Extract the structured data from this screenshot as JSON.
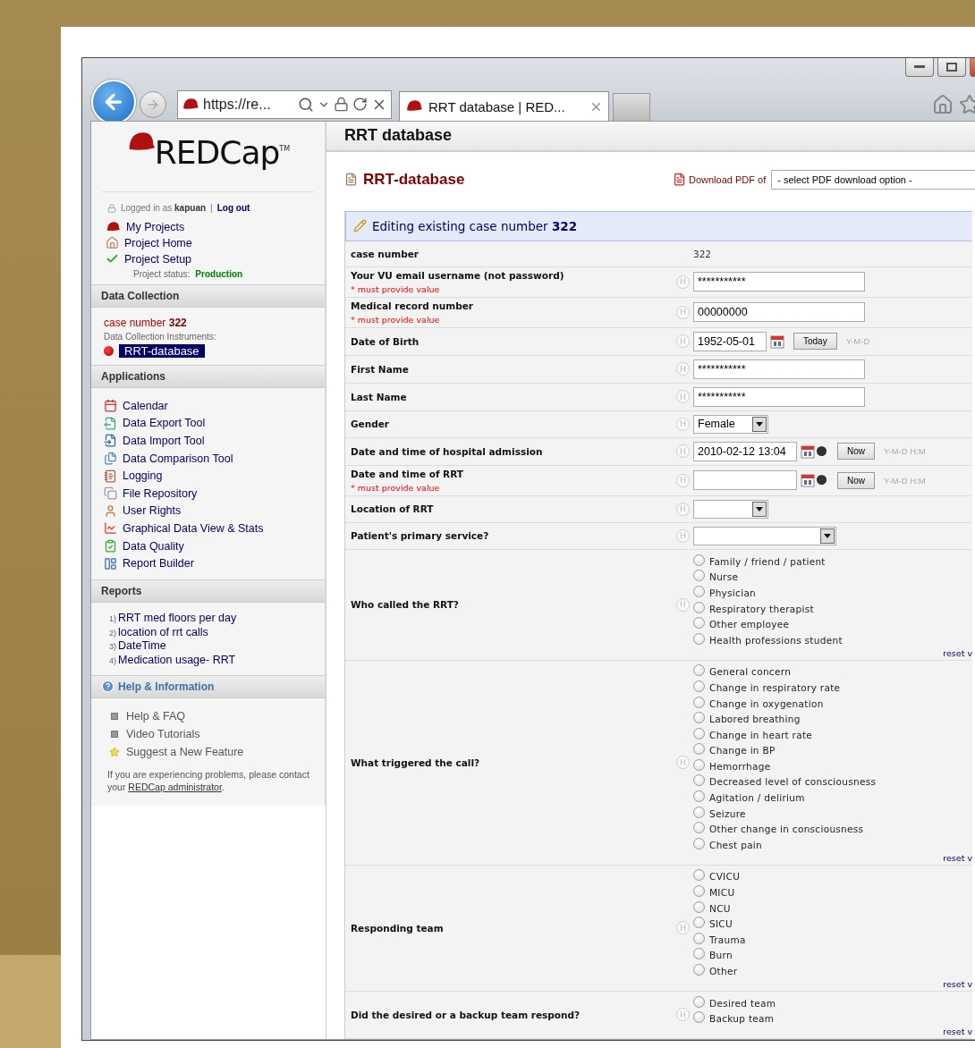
{
  "browser": {
    "address": "https://re...",
    "tab_title": "RRT database | RED..."
  },
  "sidebar": {
    "logo": "REDCap",
    "logo_mark": "TM",
    "login": {
      "prefix": "Logged in as",
      "user": "kapuan",
      "separator": "|",
      "logout": "Log out"
    },
    "nav": [
      {
        "label": "My Projects"
      },
      {
        "label": "Project Home"
      },
      {
        "label": "Project Setup"
      }
    ],
    "project_status": {
      "label": "Project status:",
      "value": "Production"
    },
    "data_collection": {
      "title": "Data Collection",
      "record_label": "case number",
      "record_value": "322",
      "instruments_label": "Data Collection Instruments:",
      "instruments": [
        {
          "label": "RRT-database",
          "selected": true
        }
      ]
    },
    "applications": {
      "title": "Applications",
      "items": [
        {
          "label": "Calendar"
        },
        {
          "label": "Data Export Tool"
        },
        {
          "label": "Data Import Tool"
        },
        {
          "label": "Data Comparison Tool"
        },
        {
          "label": "Logging"
        },
        {
          "label": "File Repository"
        },
        {
          "label": "User Rights"
        },
        {
          "label": "Graphical Data View & Stats"
        },
        {
          "label": "Data Quality"
        },
        {
          "label": "Report Builder"
        }
      ]
    },
    "reports": {
      "title": "Reports",
      "items": [
        {
          "number": "1)",
          "label": "RRT med floors per day"
        },
        {
          "number": "2)",
          "label": "location of rrt calls"
        },
        {
          "number": "3)",
          "label": "DateTime"
        },
        {
          "number": "4)",
          "label": "Medication usage- RRT"
        }
      ]
    },
    "help": {
      "title": "Help & Information",
      "items": [
        {
          "kind": "bullet",
          "label": "Help & FAQ"
        },
        {
          "kind": "bullet",
          "label": "Video Tutorials"
        },
        {
          "kind": "star",
          "label": "Suggest a New Feature"
        }
      ],
      "note": "If you are experiencing problems, please contact your",
      "note_link": "REDCap administrator",
      "note_end": "."
    }
  },
  "main": {
    "page_title": "RRT database",
    "form_title": "RRT-database",
    "pdf": {
      "label": "Download PDF of",
      "select": "- select PDF download option -"
    },
    "editing": {
      "prefix": "Editing existing case number",
      "number": "322"
    },
    "fields": [
      {
        "kind": "static",
        "label": "case number",
        "value": "322"
      },
      {
        "kind": "text",
        "label": "Your VU email username (not password)",
        "note": "* must provide value",
        "help": "H",
        "value": "***********"
      },
      {
        "kind": "text",
        "label": "Medical record number",
        "note": "* must provide value",
        "help": "H",
        "value": "00000000"
      },
      {
        "kind": "date",
        "label": "Date of Birth",
        "help": "H",
        "value": "1952-05-01",
        "button": "Today",
        "format": "Y-M-D"
      },
      {
        "kind": "text",
        "label": "First Name",
        "help": "H",
        "value": "***********"
      },
      {
        "kind": "text",
        "label": "Last Name",
        "help": "H",
        "value": "***********"
      },
      {
        "kind": "select",
        "label": "Gender",
        "help": "H",
        "value": "Female"
      },
      {
        "kind": "datetime",
        "label": "Date and time of hospital admission",
        "help": "H",
        "value": "2010-02-12 13:04",
        "button": "Now",
        "format": "Y-M-D H:M"
      },
      {
        "kind": "datetime",
        "label": "Date and time of RRT",
        "note": "* must provide value",
        "help": "H",
        "button": "Now",
        "format": "Y-M-D H:M"
      },
      {
        "kind": "select",
        "label": "Location of RRT",
        "help": "H"
      },
      {
        "kind": "select_wide",
        "label": "Patient's primary service?",
        "help": "H"
      },
      {
        "kind": "radio",
        "label": "Who called the RRT?",
        "help": "H",
        "reset": "reset v",
        "options": [
          {
            "label": "Family / friend / patient",
            "selected": false
          },
          {
            "label": "Nurse",
            "selected": false
          },
          {
            "label": "Physician",
            "selected": false
          },
          {
            "label": "Respiratory therapist",
            "selected": false
          },
          {
            "label": "Other employee",
            "selected": false
          },
          {
            "label": "Health professions student",
            "selected": false
          }
        ]
      },
      {
        "kind": "radio",
        "label": "What triggered the call?",
        "help": "H",
        "reset": "reset v",
        "options": [
          {
            "label": "General concern",
            "selected": false
          },
          {
            "label": "Change in respiratory rate",
            "selected": false
          },
          {
            "label": "Change in oxygenation",
            "selected": false
          },
          {
            "label": "Labored breathing",
            "selected": false
          },
          {
            "label": "Change in heart rate",
            "selected": false
          },
          {
            "label": "Change in BP",
            "selected": false
          },
          {
            "label": "Hemorrhage",
            "selected": false
          },
          {
            "label": "Decreased level of consciousness",
            "selected": false
          },
          {
            "label": "Agitation / delirium",
            "selected": false
          },
          {
            "label": "Seizure",
            "selected": false
          },
          {
            "label": "Other change in consciousness",
            "selected": false
          },
          {
            "label": "Chest pain",
            "selected": false
          }
        ]
      },
      {
        "kind": "radio",
        "label": "Responding team",
        "help": "H",
        "reset": "reset v",
        "options": [
          {
            "label": "CVICU",
            "selected": false
          },
          {
            "label": "MICU",
            "selected": false
          },
          {
            "label": "NCU",
            "selected": false
          },
          {
            "label": "SICU",
            "selected": false
          },
          {
            "label": "Trauma",
            "selected": false
          },
          {
            "label": "Burn",
            "selected": false
          },
          {
            "label": "Other",
            "selected": false
          }
        ]
      },
      {
        "kind": "radio",
        "label": "Did the desired or a backup team respond?",
        "help": "H",
        "reset": "reset v",
        "options": [
          {
            "label": "Desired team",
            "selected": false
          },
          {
            "label": "Backup team",
            "selected": false
          }
        ]
      }
    ]
  }
}
